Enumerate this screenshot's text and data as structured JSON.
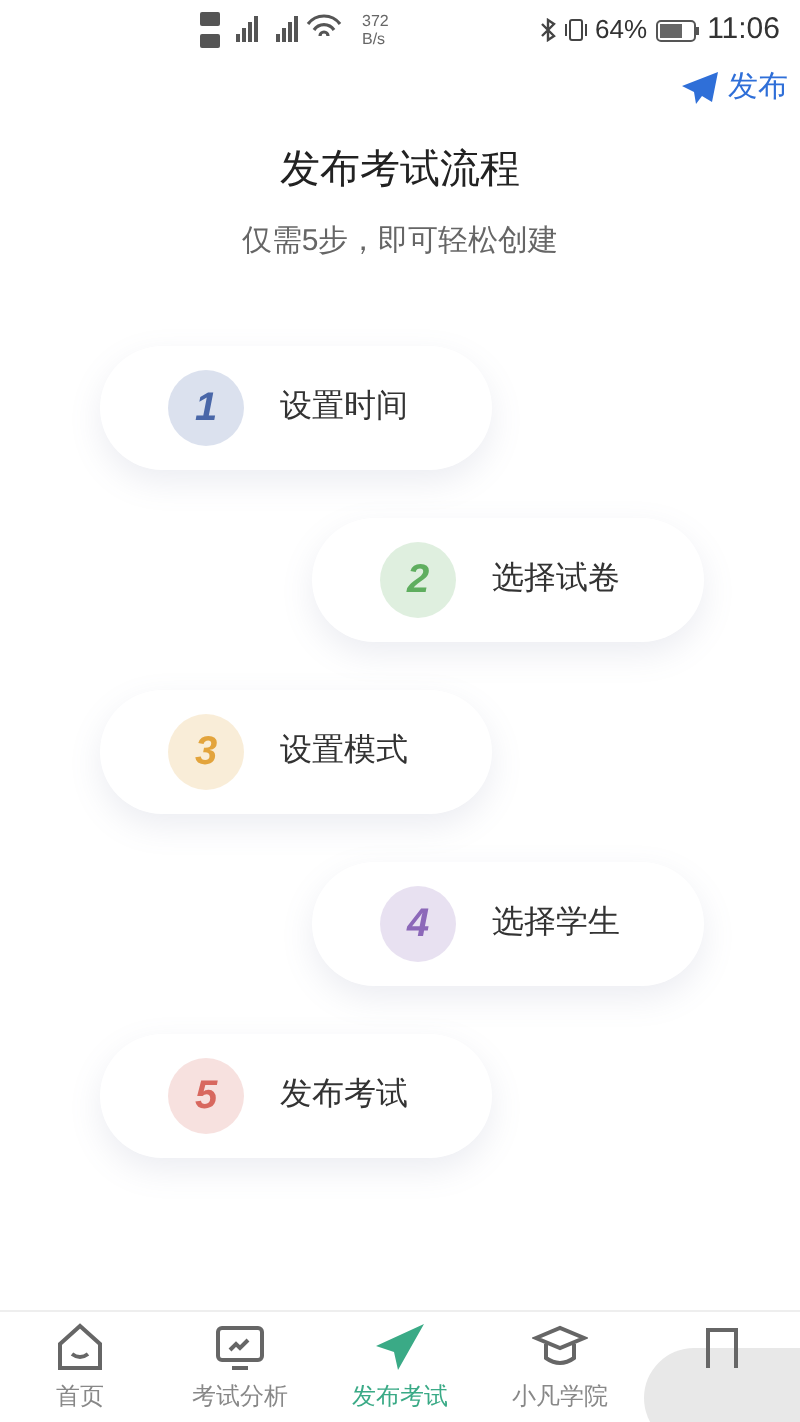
{
  "status_bar": {
    "net_speed": "372",
    "net_unit": "B/s",
    "battery": "64%",
    "time": "11:06"
  },
  "header": {
    "action": "发布"
  },
  "intro": {
    "title": "发布考试流程",
    "subtitle": "仅需5步，即可轻松创建"
  },
  "steps": [
    {
      "number": "1",
      "label": "设置时间",
      "color": "#4a67a8"
    },
    {
      "number": "2",
      "label": "选择试卷",
      "color": "#5fae5f"
    },
    {
      "number": "3",
      "label": "设置模式",
      "color": "#e3a43c"
    },
    {
      "number": "4",
      "label": "选择学生",
      "color": "#8c68b9"
    },
    {
      "number": "5",
      "label": "发布考试",
      "color": "#d8685f"
    }
  ],
  "tab_bar": [
    {
      "kind": "home",
      "label": "首页",
      "selected": false
    },
    {
      "kind": "chart",
      "label": "考试分析",
      "selected": false
    },
    {
      "kind": "send",
      "label": "发布考试",
      "selected": true
    },
    {
      "kind": "school",
      "label": "小凡学院",
      "selected": false
    }
  ]
}
